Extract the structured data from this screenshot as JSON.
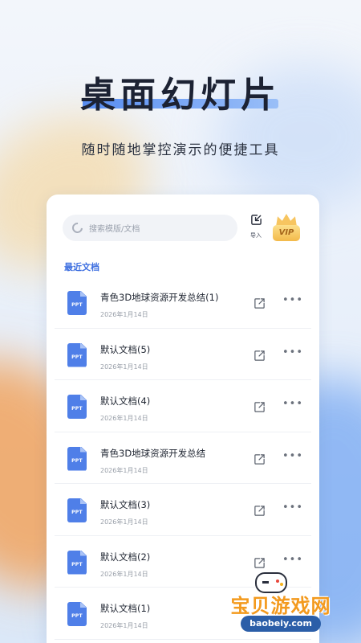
{
  "hero": {
    "title": "桌面幻灯片",
    "subtitle": "随时随地掌控演示的便捷工具"
  },
  "toolbar": {
    "search_placeholder": "搜索模版/文档",
    "import_label": "导入",
    "vip_label": "VIP"
  },
  "section_title": "最近文档",
  "documents": [
    {
      "name": "青色3D地球资源开发总结(1)",
      "date": "2026年1月14日",
      "type": "PPT"
    },
    {
      "name": "默认文档(5)",
      "date": "2026年1月14日",
      "type": "PPT"
    },
    {
      "name": "默认文档(4)",
      "date": "2026年1月14日",
      "type": "PPT"
    },
    {
      "name": "青色3D地球资源开发总结",
      "date": "2026年1月14日",
      "type": "PPT"
    },
    {
      "name": "默认文档(3)",
      "date": "2026年1月14日",
      "type": "PPT"
    },
    {
      "name": "默认文档(2)",
      "date": "2026年1月14日",
      "type": "PPT"
    },
    {
      "name": "默认文档(1)",
      "date": "2026年1月14日",
      "type": "PPT"
    }
  ],
  "icons": {
    "search": "search-icon",
    "import": "import-icon",
    "share": "share-icon",
    "more": "more-icon",
    "file": "ppt-file-icon"
  },
  "watermark": {
    "text": "宝贝游戏网",
    "domain": "baobeiy.com"
  },
  "colors": {
    "accent": "#3e6fe0",
    "file_icon": "#4f7fe8",
    "vip": "#f3b94a"
  }
}
